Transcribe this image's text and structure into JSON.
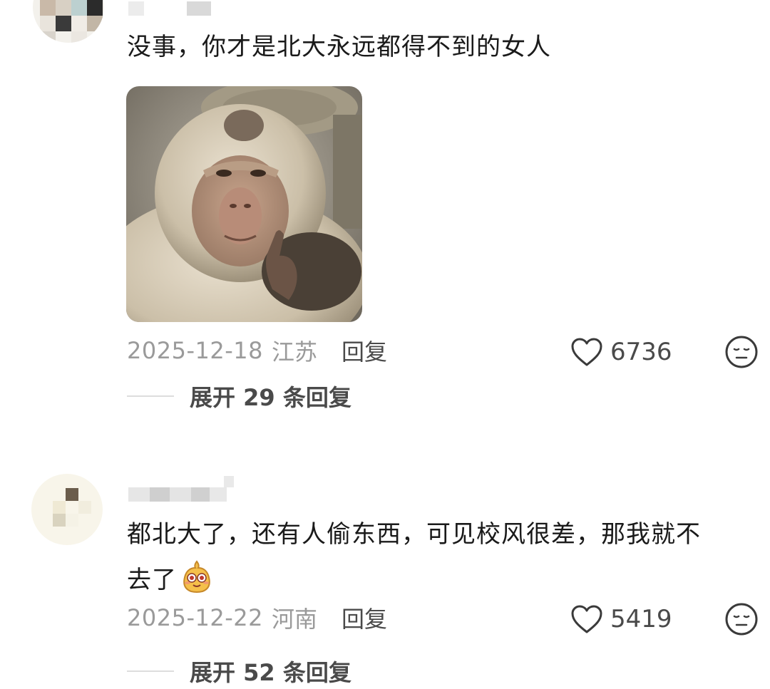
{
  "comments": [
    {
      "text_lines": [
        "没事，你才是北大永远都得不到的女人"
      ],
      "date": "2025-12-18",
      "region": "江苏",
      "reply_label": "回复",
      "likes": "6736",
      "expand_label": "展开 29 条回复",
      "has_image": true
    },
    {
      "text_lines": [
        "都北大了，还有人偷东西，可见校风很差，那我就不",
        "去了"
      ],
      "date": "2025-12-22",
      "region": "河南",
      "reply_label": "回复",
      "likes": "5419",
      "expand_label": "展开 52 条回复",
      "has_emoji": true
    }
  ],
  "icons": {
    "like": "heart-outline-icon",
    "dislike": "neutral-face-icon",
    "emoji": "blushing-smiley-emoji"
  },
  "colors": {
    "text_primary": "#1a1a1a",
    "text_meta": "#9a9a9a",
    "text_action": "#4a4a4a"
  }
}
